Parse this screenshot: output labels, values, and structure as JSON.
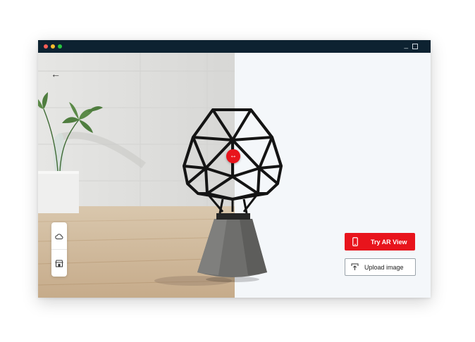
{
  "window": {
    "controls": {
      "minimize": "_"
    }
  },
  "viewer": {
    "back_icon": "arrow-left-icon",
    "back_glyph": "←",
    "swap_glyph": "↔",
    "toolbar": [
      {
        "icon": "cloud-icon"
      },
      {
        "icon": "store-icon"
      }
    ]
  },
  "actions": {
    "ar_label": "Try AR View",
    "upload_label": "Upload image"
  },
  "colors": {
    "accent": "#e8141c",
    "titlebar": "#0d2231"
  }
}
